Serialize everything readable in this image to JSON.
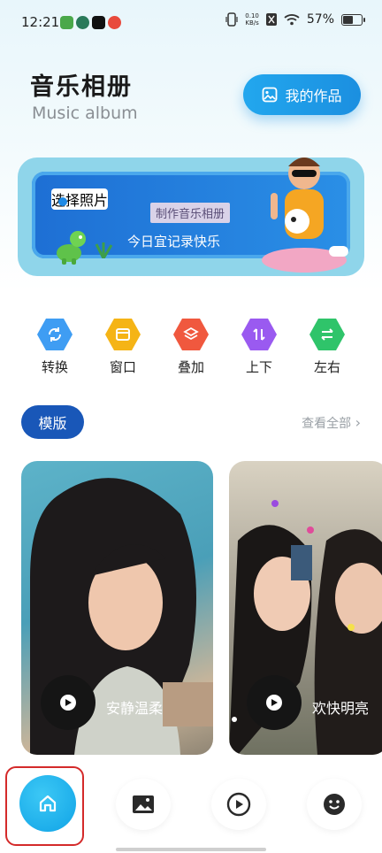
{
  "status_bar": {
    "time": "12:21",
    "net_speed_value": "0.10",
    "net_speed_unit": "KB/s",
    "battery_pct": "57%",
    "battery_level": 0.57
  },
  "header": {
    "title_cn": "音乐相册",
    "title_en": "Music album",
    "my_works_label": "我的作品"
  },
  "banner": {
    "select_photos": "选择照片",
    "make_album": "制作音乐相册",
    "tagline": "今日宜记录快乐"
  },
  "categories": [
    {
      "label": "转换",
      "color": "#3f9df3",
      "icon": "refresh-icon"
    },
    {
      "label": "窗口",
      "color": "#f5b416",
      "icon": "window-icon"
    },
    {
      "label": "叠加",
      "color": "#f0583e",
      "icon": "layers-icon"
    },
    {
      "label": "上下",
      "color": "#9a5af0",
      "icon": "up-down-icon"
    },
    {
      "label": "左右",
      "color": "#2fc46a",
      "icon": "left-right-icon"
    }
  ],
  "templates": {
    "tag": "模版",
    "view_all": "查看全部",
    "cards": [
      {
        "name": "安静温柔"
      },
      {
        "name": "欢快明亮"
      }
    ]
  },
  "nav": {
    "items": [
      "home-icon",
      "gallery-icon",
      "play-icon",
      "smile-icon"
    ],
    "active_color": "#10a3e6"
  }
}
